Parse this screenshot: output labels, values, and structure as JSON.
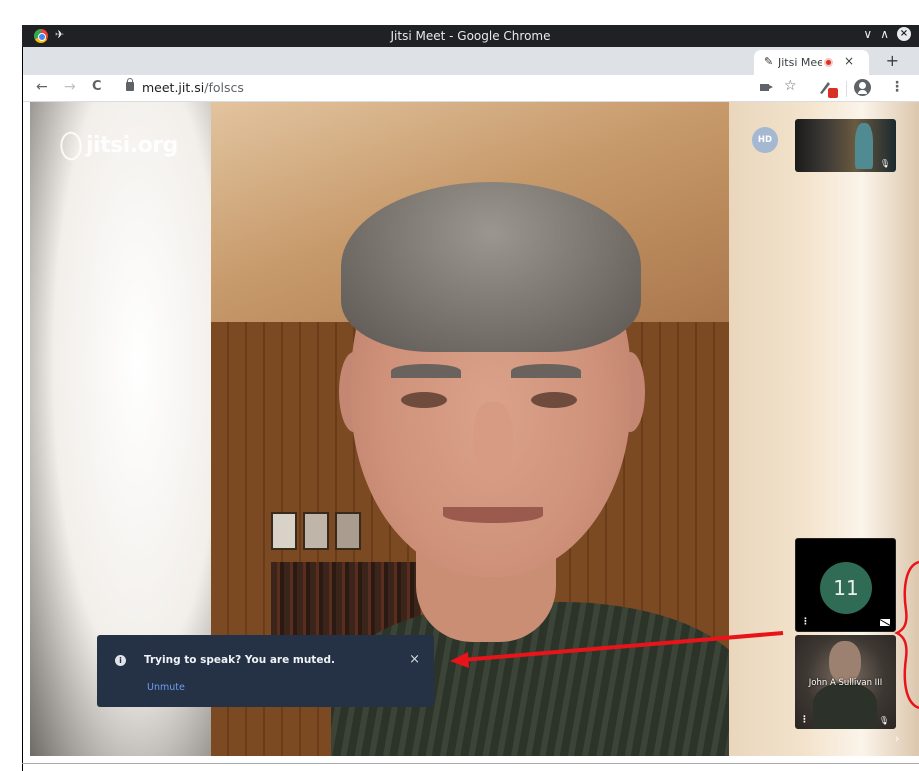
{
  "window": {
    "title": "Jitsi Meet - Google Chrome"
  },
  "tab": {
    "label": "Jitsi Mee",
    "close": "×",
    "new_tab": "+"
  },
  "toolbar": {
    "back": "←",
    "forward": "→",
    "reload": "C",
    "url_host": "meet.jit.si",
    "url_path": "/folscs",
    "menu": "⋮"
  },
  "watermark": {
    "text": "jitsi.org"
  },
  "participants": {
    "avatar_initials": "HD",
    "count_avatar": "11",
    "john_name": "John A Sullivan III",
    "thumb_menu": "⋮"
  },
  "notification": {
    "title": "Trying to speak? You are muted.",
    "action": "Unmute",
    "close": "×"
  },
  "colors": {
    "chrome_titlebar": "#202124",
    "notification_bg": "#253245",
    "link": "#6c9cf2",
    "annotation": "#e8141a",
    "avatar_11": "#2f6b55"
  }
}
